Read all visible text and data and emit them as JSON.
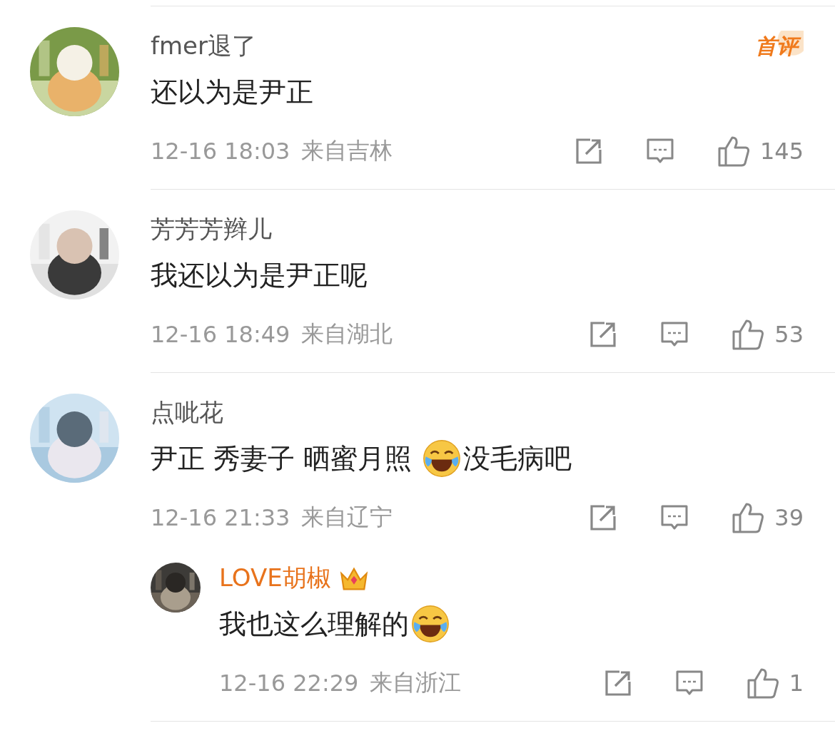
{
  "comments": [
    {
      "name": "fmer退了",
      "vip": false,
      "badge": "首评",
      "text": [
        {
          "kind": "text",
          "text": "还以为是尹正"
        }
      ],
      "time": "12-16 18:03",
      "location": "来自吉林",
      "likes": "145"
    },
    {
      "name": "芳芳芳辫儿",
      "vip": false,
      "text": [
        {
          "kind": "text",
          "text": "我还以为是尹正呢"
        }
      ],
      "time": "12-16 18:49",
      "location": "来自湖北",
      "likes": "53"
    },
    {
      "name": "点呲花",
      "vip": false,
      "text": [
        {
          "kind": "text",
          "text": "尹正 秀妻子 晒蜜月照 "
        },
        {
          "kind": "emoji"
        },
        {
          "kind": "text",
          "text": "没毛病吧"
        }
      ],
      "time": "12-16 21:33",
      "location": "来自辽宁",
      "likes": "39",
      "replies": [
        {
          "name": "LOVE胡椒",
          "vip": true,
          "text": [
            {
              "kind": "text",
              "text": "我也这么理解的"
            },
            {
              "kind": "emoji"
            }
          ],
          "time": "12-16 22:29",
          "location": "来自浙江",
          "likes": "1"
        }
      ]
    }
  ]
}
